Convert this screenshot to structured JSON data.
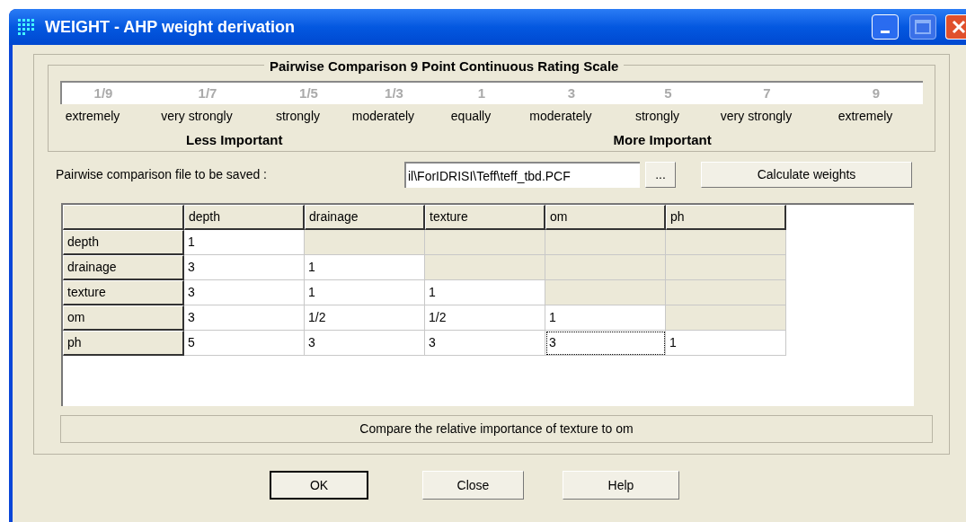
{
  "window": {
    "title": "WEIGHT - AHP weight derivation"
  },
  "scale": {
    "title": "Pairwise Comparison 9 Point Continuous Rating Scale",
    "points": [
      {
        "value": "1/9",
        "label": "extremely"
      },
      {
        "value": "1/7",
        "label": "very strongly"
      },
      {
        "value": "1/5",
        "label": "strongly"
      },
      {
        "value": "1/3",
        "label": "moderately"
      },
      {
        "value": "1",
        "label": "equally"
      },
      {
        "value": "3",
        "label": "moderately"
      },
      {
        "value": "5",
        "label": "strongly"
      },
      {
        "value": "7",
        "label": "very strongly"
      },
      {
        "value": "9",
        "label": "extremely"
      }
    ],
    "less_label": "Less Important",
    "more_label": "More Important"
  },
  "file": {
    "label": "Pairwise comparison file to be saved :",
    "value": "il\\ForIDRISI\\Teff\\teff_tbd.PCF",
    "browse": "...",
    "calculate": "Calculate weights"
  },
  "matrix": {
    "columns": [
      "depth",
      "drainage",
      "texture",
      "om",
      "ph"
    ],
    "rows": [
      {
        "name": "depth",
        "cells": [
          {
            "value": "1",
            "editable": true,
            "focused": false
          },
          {
            "editable": false,
            "focused": false
          },
          {
            "editable": false,
            "focused": false
          },
          {
            "editable": false,
            "focused": false
          },
          {
            "editable": false,
            "focused": false
          }
        ]
      },
      {
        "name": "drainage",
        "cells": [
          {
            "value": "3",
            "editable": true,
            "focused": false
          },
          {
            "value": "1",
            "editable": true,
            "focused": false
          },
          {
            "editable": false,
            "focused": false
          },
          {
            "editable": false,
            "focused": false
          },
          {
            "editable": false,
            "focused": false
          }
        ]
      },
      {
        "name": "texture",
        "cells": [
          {
            "value": "3",
            "editable": true,
            "focused": false
          },
          {
            "value": "1",
            "editable": true,
            "focused": false
          },
          {
            "value": "1",
            "editable": true,
            "focused": false
          },
          {
            "editable": false,
            "focused": false
          },
          {
            "editable": false,
            "focused": false
          }
        ]
      },
      {
        "name": "om",
        "cells": [
          {
            "value": "3",
            "editable": true,
            "focused": false
          },
          {
            "value": "1/2",
            "editable": true,
            "focused": false
          },
          {
            "value": "1/2",
            "editable": true,
            "focused": false
          },
          {
            "value": "1",
            "editable": true,
            "focused": false
          },
          {
            "editable": false,
            "focused": false
          }
        ]
      },
      {
        "name": "ph",
        "cells": [
          {
            "value": "5",
            "editable": true,
            "focused": false
          },
          {
            "value": "3",
            "editable": true,
            "focused": false
          },
          {
            "value": "3",
            "editable": true,
            "focused": false
          },
          {
            "value": "3",
            "editable": true,
            "focused": true
          },
          {
            "value": "1",
            "editable": true,
            "focused": false
          }
        ]
      }
    ]
  },
  "status": "Compare the relative importance of texture to om",
  "buttons": [
    {
      "label": "OK",
      "default": true
    },
    {
      "label": "Close",
      "default": false
    },
    {
      "label": "Help",
      "default": false
    }
  ]
}
